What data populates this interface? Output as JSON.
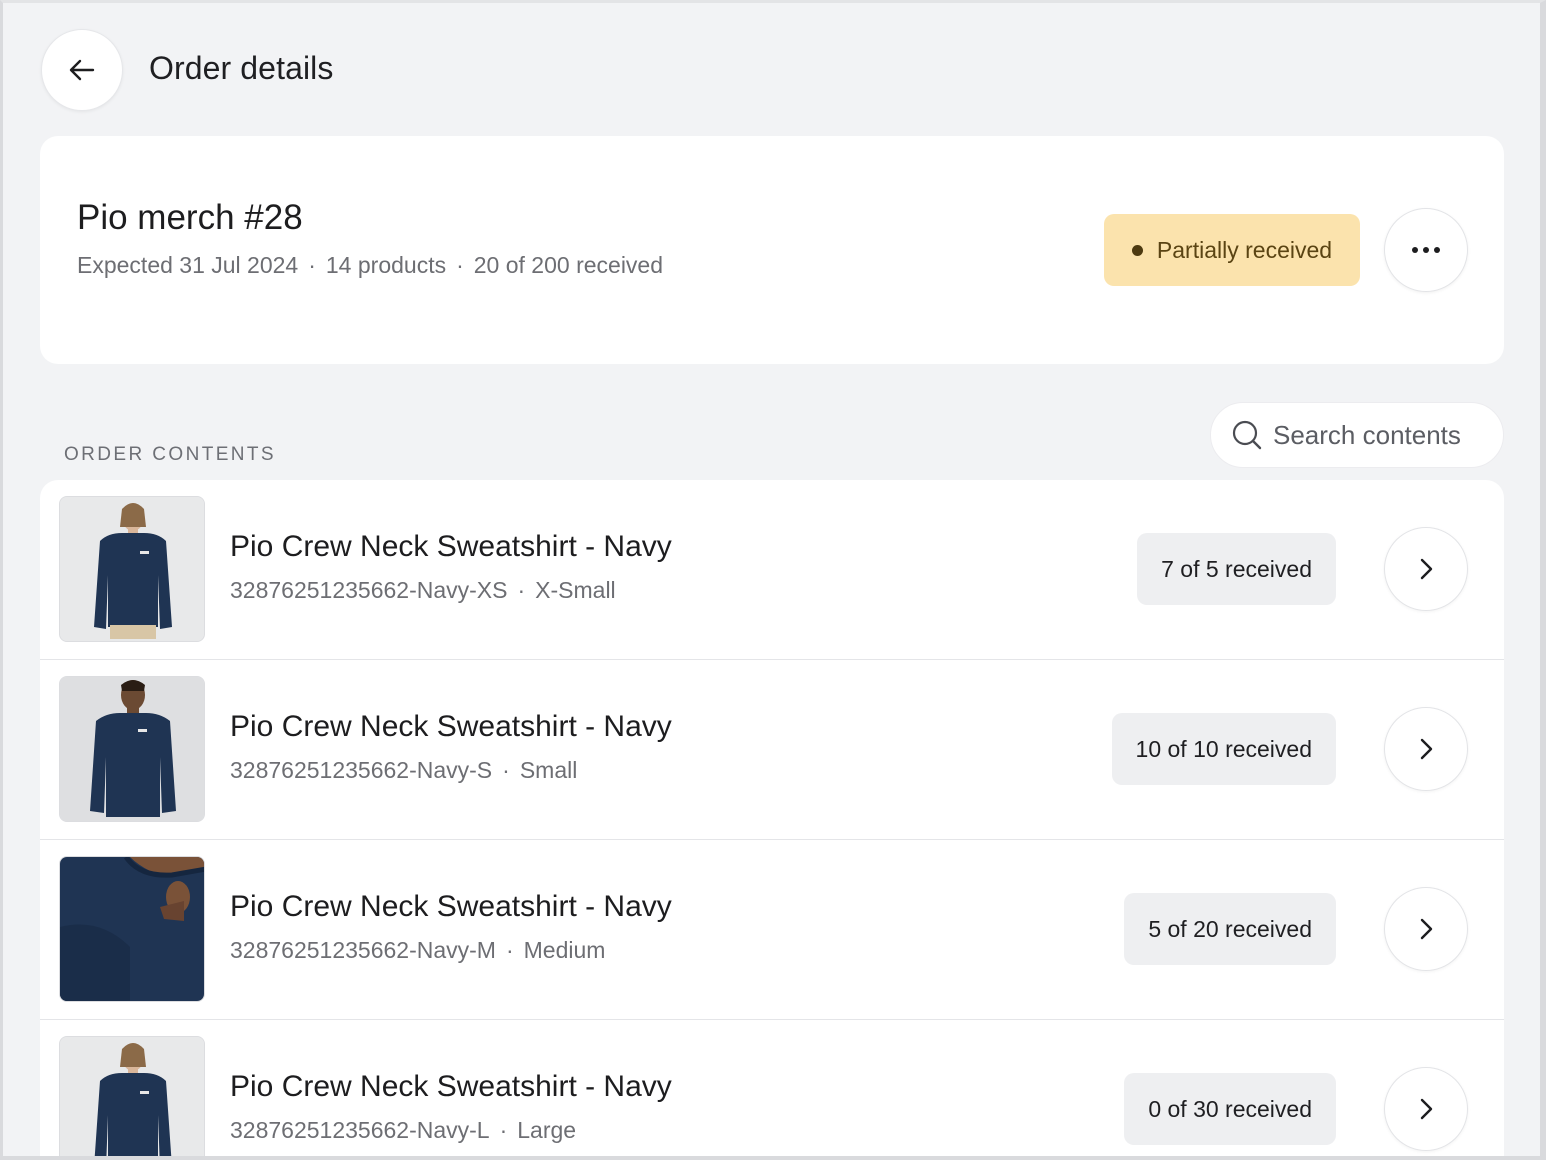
{
  "header": {
    "title": "Order details",
    "back_icon": "arrow-left-icon"
  },
  "order": {
    "name": "Pio merch #28",
    "expected": "Expected 31 Jul 2024",
    "products": "14 products",
    "received": "20 of 200 received",
    "status": "Partially received",
    "status_color": "#fbe3ad"
  },
  "contents": {
    "section_label": "ORDER CONTENTS",
    "search_placeholder": "Search contents",
    "items": [
      {
        "name": "Pio Crew Neck Sweatshirt - Navy",
        "sku": "32876251235662-Navy-XS",
        "size": "X-Small",
        "qty": "7 of 5 received"
      },
      {
        "name": "Pio Crew Neck Sweatshirt - Navy",
        "sku": "32876251235662-Navy-S",
        "size": "Small",
        "qty": "10 of 10 received"
      },
      {
        "name": "Pio Crew Neck Sweatshirt - Navy",
        "sku": "32876251235662-Navy-M",
        "size": "Medium",
        "qty": "5 of 20 received"
      },
      {
        "name": "Pio Crew Neck Sweatshirt - Navy",
        "sku": "32876251235662-Navy-L",
        "size": "Large",
        "qty": "0 of 30 received"
      }
    ]
  },
  "colors": {
    "background": "#f2f3f5",
    "card": "#ffffff",
    "navy": "#1f3453"
  }
}
